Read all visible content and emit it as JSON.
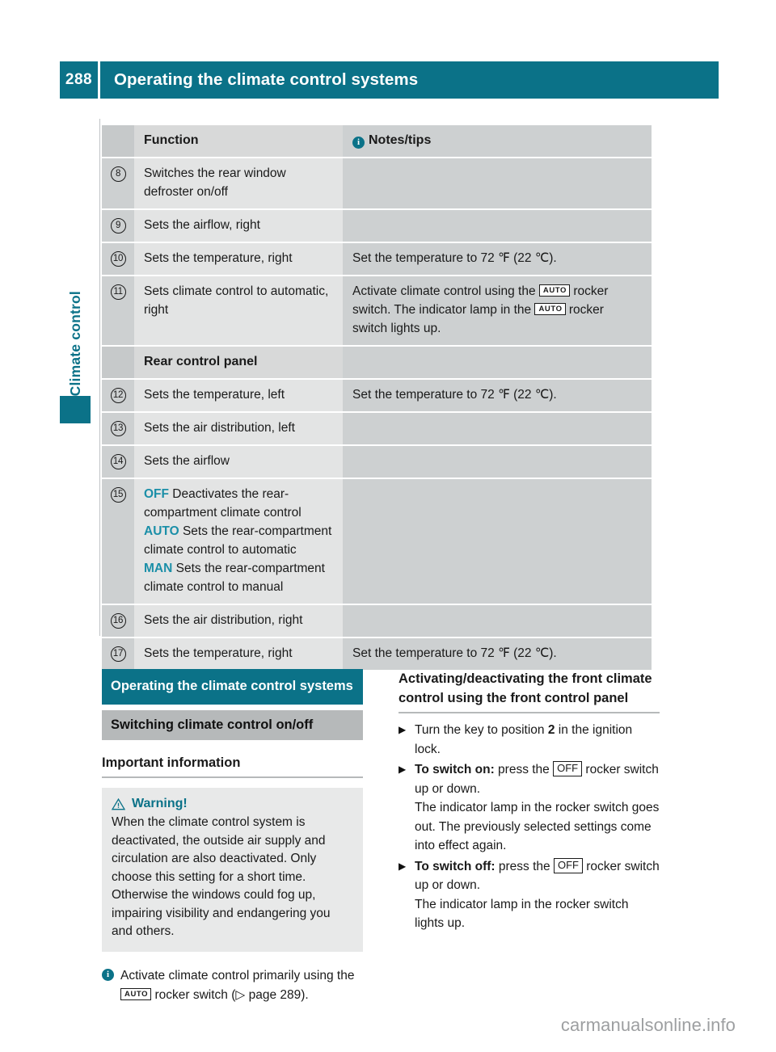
{
  "colors": {
    "teal": "#0b7288",
    "teal_keyword": "#1b8fa8",
    "row_light": "#e3e4e4",
    "row_dark": "#cdd0d1",
    "banner_gray": "#b6b9ba",
    "watermark": "#9d9fa1"
  },
  "header": {
    "page_number": "288",
    "title": "Operating the climate control systems"
  },
  "sidebar": {
    "chapter_label": "Climate control"
  },
  "table": {
    "columns": {
      "marker": "",
      "function": "Function",
      "notes": "Notes/tips",
      "notes_icon": "info-icon"
    },
    "rows": [
      {
        "marker": "8",
        "function": "Switches the rear window defroster on/off",
        "notes": ""
      },
      {
        "marker": "9",
        "function": "Sets the airflow, right",
        "notes": ""
      },
      {
        "marker": "10",
        "function": "Sets the temperature, right",
        "notes": "Set the temperature to 72 ℉ (22 ℃)."
      },
      {
        "marker": "11",
        "function": "Sets climate control to automatic, right",
        "notes_parts": [
          "Activate climate control using the ",
          "AUTO",
          " rocker switch. The indicator lamp in the ",
          "AUTO",
          " rocker switch lights up."
        ]
      },
      {
        "section_title": "Rear control panel"
      },
      {
        "marker": "12",
        "function": "Sets the temperature, left",
        "notes": "Set the temperature to 72 ℉ (22 ℃)."
      },
      {
        "marker": "13",
        "function": "Sets the air distribution, left",
        "notes": ""
      },
      {
        "marker": "14",
        "function": "Sets the airflow",
        "notes": ""
      },
      {
        "marker": "15",
        "function_items": [
          {
            "keyword": "OFF",
            "text": " Deactivates the rear-compartment climate control"
          },
          {
            "keyword": "AUTO",
            "text": " Sets the rear-compartment climate control to automatic"
          },
          {
            "keyword": "MAN",
            "text": " Sets the rear-compartment climate control to manual"
          }
        ],
        "notes": ""
      },
      {
        "marker": "16",
        "function": "Sets the air distribution, right",
        "notes": ""
      },
      {
        "marker": "17",
        "function": "Sets the temperature, right",
        "notes": "Set the temperature to 72 ℉ (22 ℃)."
      }
    ]
  },
  "left_column": {
    "section_banner": "Operating the climate control systems",
    "sub_banner": "Switching climate control on/off",
    "heading": "Important information",
    "warning": {
      "icon": "warning-triangle-icon",
      "title": "Warning!",
      "body": "When the climate control system is deactivated, the outside air supply and circulation are also deactivated. Only choose this setting for a short time. Otherwise the windows could fog up, impairing visibility and endangering you and others."
    },
    "tip": {
      "icon": "info-icon",
      "parts": [
        "Activate climate control primarily using the ",
        "AUTO",
        " rocker switch (▷ page 289)."
      ]
    }
  },
  "right_column": {
    "heading": "Activating/deactivating the front climate control using the front control panel",
    "steps": [
      {
        "bullet": "arrow-right-icon",
        "parts": [
          {
            "t": "Turn the key to position "
          },
          {
            "t": "2",
            "bold": true
          },
          {
            "t": " in the ignition lock."
          }
        ]
      },
      {
        "bullet": "arrow-right-icon",
        "parts": [
          {
            "t": "To switch on:",
            "bold": true
          },
          {
            "t": " press the "
          },
          {
            "t": "OFF",
            "switch": true
          },
          {
            "t": " rocker switch up or down."
          },
          {
            "t": "\nThe indicator lamp in the rocker switch goes out. The previously selected settings come into effect again."
          }
        ]
      },
      {
        "bullet": "arrow-right-icon",
        "parts": [
          {
            "t": "To switch off:",
            "bold": true
          },
          {
            "t": " press the "
          },
          {
            "t": "OFF",
            "switch": true
          },
          {
            "t": " rocker switch up or down."
          },
          {
            "t": "\nThe indicator lamp in the rocker switch lights up."
          }
        ]
      }
    ]
  },
  "watermark": "carmanualsonline.info"
}
